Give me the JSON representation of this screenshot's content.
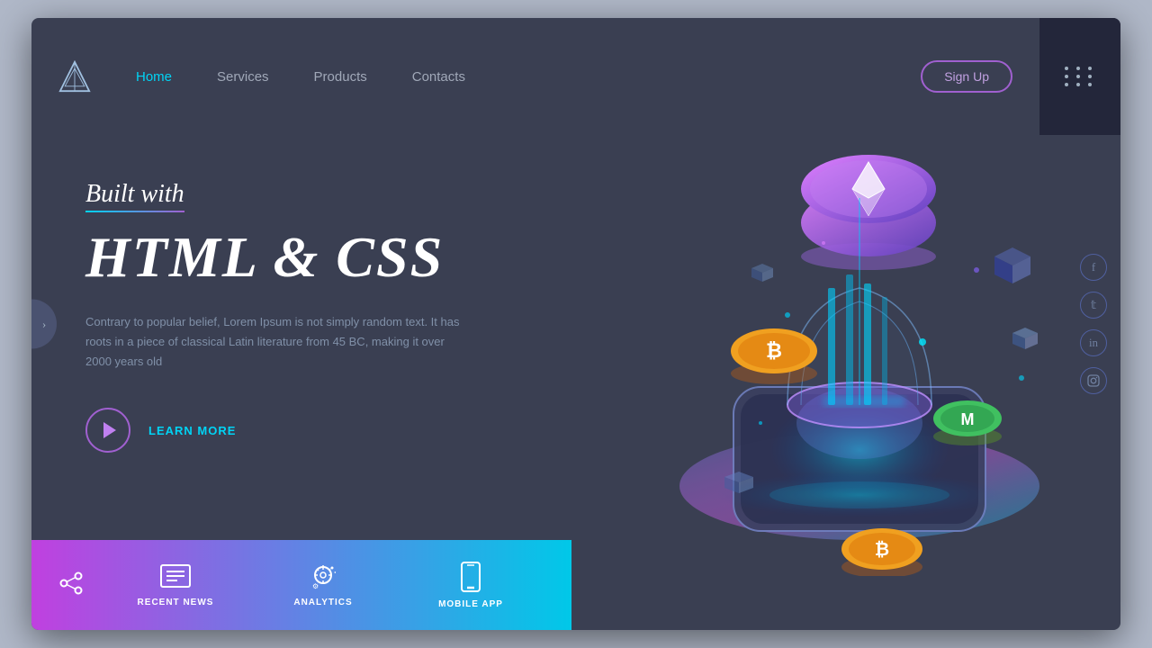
{
  "meta": {
    "title": "Built with HTML & CSS"
  },
  "navbar": {
    "links": [
      {
        "label": "Home",
        "active": true
      },
      {
        "label": "Services",
        "active": false
      },
      {
        "label": "Products",
        "active": false
      },
      {
        "label": "Contacts",
        "active": false
      }
    ],
    "signup_label": "Sign Up"
  },
  "hero": {
    "subtitle": "Built with",
    "heading": "HTML & CSS",
    "description": "Contrary to popular belief, Lorem Ipsum is not simply random text. It has roots in a piece of classical Latin literature from 45 BC, making it over 2000 years old",
    "cta_label": "LEARN MORE"
  },
  "bottom_bar": {
    "items": [
      {
        "label": "RECENT NEWS"
      },
      {
        "label": "ANALYTICS"
      },
      {
        "label": "MOBILE APP"
      }
    ]
  },
  "social": {
    "icons": [
      "f",
      "t",
      "in",
      "ig"
    ]
  }
}
